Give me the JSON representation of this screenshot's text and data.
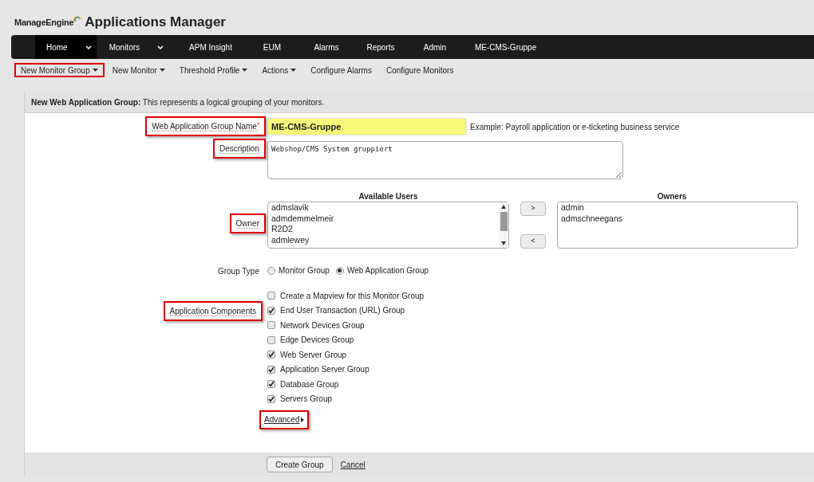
{
  "brand": {
    "company": "ManageEngine",
    "product": "Applications Manager"
  },
  "nav": [
    {
      "label": "Home",
      "selected": true,
      "dropdown": true
    },
    {
      "label": "Monitors",
      "selected": false,
      "dropdown": true
    },
    {
      "label": "APM Insight",
      "selected": false,
      "dropdown": false
    },
    {
      "label": "EUM",
      "selected": false,
      "dropdown": false
    },
    {
      "label": "Alarms",
      "selected": false,
      "dropdown": false
    },
    {
      "label": "Reports",
      "selected": false,
      "dropdown": false
    },
    {
      "label": "Admin",
      "selected": false,
      "dropdown": false
    },
    {
      "label": "ME-CMS-Gruppe",
      "selected": false,
      "dropdown": false
    }
  ],
  "subnav": [
    {
      "label": "New Monitor Group",
      "dropdown": true,
      "highlighted": true
    },
    {
      "label": "New Monitor",
      "dropdown": true,
      "highlighted": false
    },
    {
      "label": "Threshold Profile",
      "dropdown": true,
      "highlighted": false
    },
    {
      "label": "Actions",
      "dropdown": true,
      "highlighted": false
    },
    {
      "label": "Configure Alarms",
      "dropdown": false,
      "highlighted": false
    },
    {
      "label": "Configure Monitors",
      "dropdown": false,
      "highlighted": false
    }
  ],
  "panel": {
    "title": "New Web Application Group:",
    "subtitle": "This represents a logical grouping of your monitors."
  },
  "name_field": {
    "label": "Web Application Group Name",
    "required": "*",
    "highlighted": true,
    "value": "ME-CMS-Gruppe",
    "hint": "Example: Payroll application or e-ticketing business service"
  },
  "description": {
    "label": "Description",
    "highlighted": true,
    "value": "Webshop/CMS System gruppiert"
  },
  "owner": {
    "label": "Owner",
    "highlighted": true,
    "available_title": "Available Users",
    "available": [
      "admslavik",
      "admdemmelmeir",
      "R2D2",
      "admlewey"
    ],
    "add_button": ">",
    "remove_button": "<",
    "owners_title": "Owners",
    "owners": [
      "admin",
      "admschneegans"
    ]
  },
  "group_type": {
    "label": "Group Type",
    "options": [
      {
        "label": "Monitor Group",
        "selected": false
      },
      {
        "label": "Web Application Group",
        "selected": true
      }
    ]
  },
  "mapview": {
    "label": "Create a Mapview for this Monitor Group",
    "checked": false
  },
  "components": {
    "label": "Application Components",
    "highlighted": true,
    "items": [
      {
        "label": "End User Transaction (URL) Group",
        "checked": true
      },
      {
        "label": "Network Devices Group",
        "checked": false
      },
      {
        "label": "Edge Devices Group",
        "checked": false
      },
      {
        "label": "Web Server Group",
        "checked": true
      },
      {
        "label": "Application Server Group",
        "checked": true
      },
      {
        "label": "Database Group",
        "checked": true
      },
      {
        "label": "Servers Group",
        "checked": true
      }
    ]
  },
  "advanced": {
    "label": "Advanced",
    "highlighted": true
  },
  "buttons": {
    "create": "Create Group",
    "cancel": "Cancel"
  }
}
